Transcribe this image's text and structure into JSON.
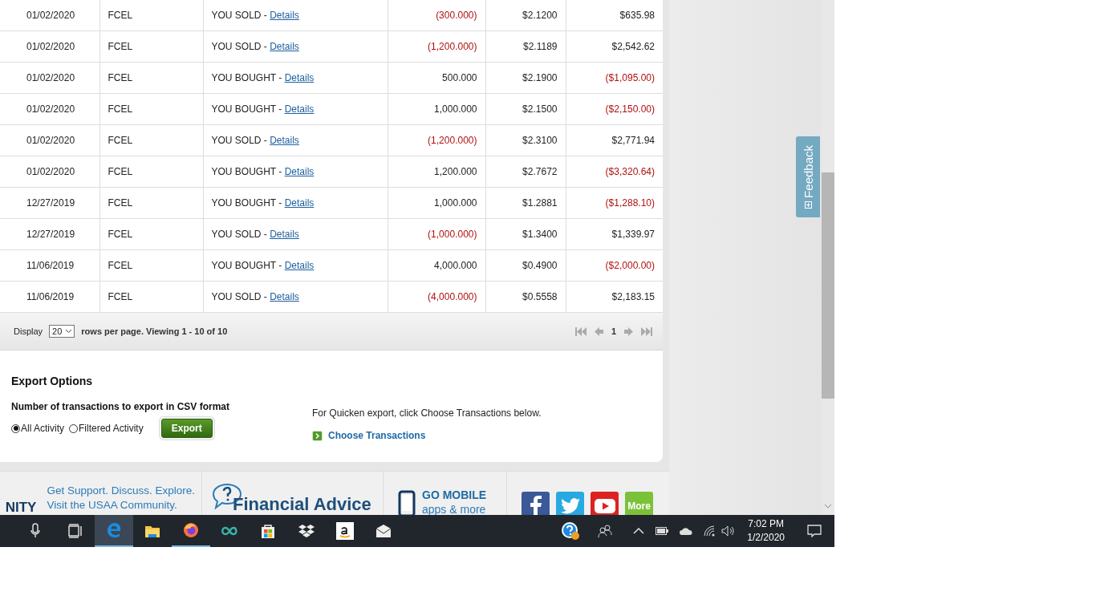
{
  "transactions": {
    "rows": [
      {
        "date": "01/02/2020",
        "symbol": "FCEL",
        "action": "YOU SOLD -",
        "link": "Details",
        "quantity": "(300.000)",
        "quantity_negative": true,
        "price": "$2.1200",
        "amount": "$635.98",
        "amount_negative": false
      },
      {
        "date": "01/02/2020",
        "symbol": "FCEL",
        "action": "YOU SOLD -",
        "link": "Details",
        "quantity": "(1,200.000)",
        "quantity_negative": true,
        "price": "$2.1189",
        "amount": "$2,542.62",
        "amount_negative": false
      },
      {
        "date": "01/02/2020",
        "symbol": "FCEL",
        "action": "YOU BOUGHT -",
        "link": "Details",
        "quantity": "500.000",
        "quantity_negative": false,
        "price": "$2.1900",
        "amount": "($1,095.00)",
        "amount_negative": true
      },
      {
        "date": "01/02/2020",
        "symbol": "FCEL",
        "action": "YOU BOUGHT -",
        "link": "Details",
        "quantity": "1,000.000",
        "quantity_negative": false,
        "price": "$2.1500",
        "amount": "($2,150.00)",
        "amount_negative": true
      },
      {
        "date": "01/02/2020",
        "symbol": "FCEL",
        "action": "YOU SOLD -",
        "link": "Details",
        "quantity": "(1,200.000)",
        "quantity_negative": true,
        "price": "$2.3100",
        "amount": "$2,771.94",
        "amount_negative": false
      },
      {
        "date": "01/02/2020",
        "symbol": "FCEL",
        "action": "YOU BOUGHT -",
        "link": "Details",
        "quantity": "1,200.000",
        "quantity_negative": false,
        "price": "$2.7672",
        "amount": "($3,320.64)",
        "amount_negative": true
      },
      {
        "date": "12/27/2019",
        "symbol": "FCEL",
        "action": "YOU BOUGHT -",
        "link": "Details",
        "quantity": "1,000.000",
        "quantity_negative": false,
        "price": "$1.2881",
        "amount": "($1,288.10)",
        "amount_negative": true
      },
      {
        "date": "12/27/2019",
        "symbol": "FCEL",
        "action": "YOU SOLD -",
        "link": "Details",
        "quantity": "(1,000.000)",
        "quantity_negative": true,
        "price": "$1.3400",
        "amount": "$1,339.97",
        "amount_negative": false
      },
      {
        "date": "11/06/2019",
        "symbol": "FCEL",
        "action": "YOU BOUGHT -",
        "link": "Details",
        "quantity": "4,000.000",
        "quantity_negative": false,
        "price": "$0.4900",
        "amount": "($2,000.00)",
        "amount_negative": true
      },
      {
        "date": "11/06/2019",
        "symbol": "FCEL",
        "action": "YOU SOLD -",
        "link": "Details",
        "quantity": "(4,000.000)",
        "quantity_negative": true,
        "price": "$0.5558",
        "amount": "$2,183.15",
        "amount_negative": false
      }
    ]
  },
  "pager": {
    "display_label": "Display",
    "page_size": "20",
    "summary": "rows per page. Viewing 1 - 10 of 10",
    "page": "1"
  },
  "export": {
    "title": "Export Options",
    "csv_label": "Number of transactions to export in CSV format",
    "options": [
      {
        "label": "All Activity",
        "selected": true
      },
      {
        "label": "Filtered Activity",
        "selected": false
      }
    ],
    "button": "Export",
    "quicken_note": "For Quicken export, click Choose Transactions below.",
    "choose_link": "Choose Transactions"
  },
  "footer": {
    "community_cut": "NITY",
    "community_lines": [
      "Get Support. Discuss. Explore.",
      "Visit the USAA Community."
    ],
    "advice_title": "Financial Advice",
    "mobile_title": "GO MOBILE",
    "mobile_sub": "apps & more",
    "social_more": "More"
  },
  "feedback": {
    "label": "Feedback"
  },
  "taskbar": {
    "apps": [
      {
        "kind": "mic",
        "active": false,
        "running": false
      },
      {
        "kind": "taskview",
        "active": false,
        "running": false
      },
      {
        "kind": "edge",
        "active": true,
        "running": true
      },
      {
        "kind": "folder",
        "active": false,
        "running": false
      },
      {
        "kind": "firefox",
        "active": false,
        "running": true
      },
      {
        "kind": "infinity",
        "active": false,
        "running": false
      },
      {
        "kind": "store",
        "active": false,
        "running": false
      },
      {
        "kind": "dropbox",
        "active": false,
        "running": false
      },
      {
        "kind": "amazon",
        "active": false,
        "running": false
      },
      {
        "kind": "mail",
        "active": false,
        "running": false
      }
    ],
    "time": "7:02 PM",
    "date": "1/2/2020"
  }
}
